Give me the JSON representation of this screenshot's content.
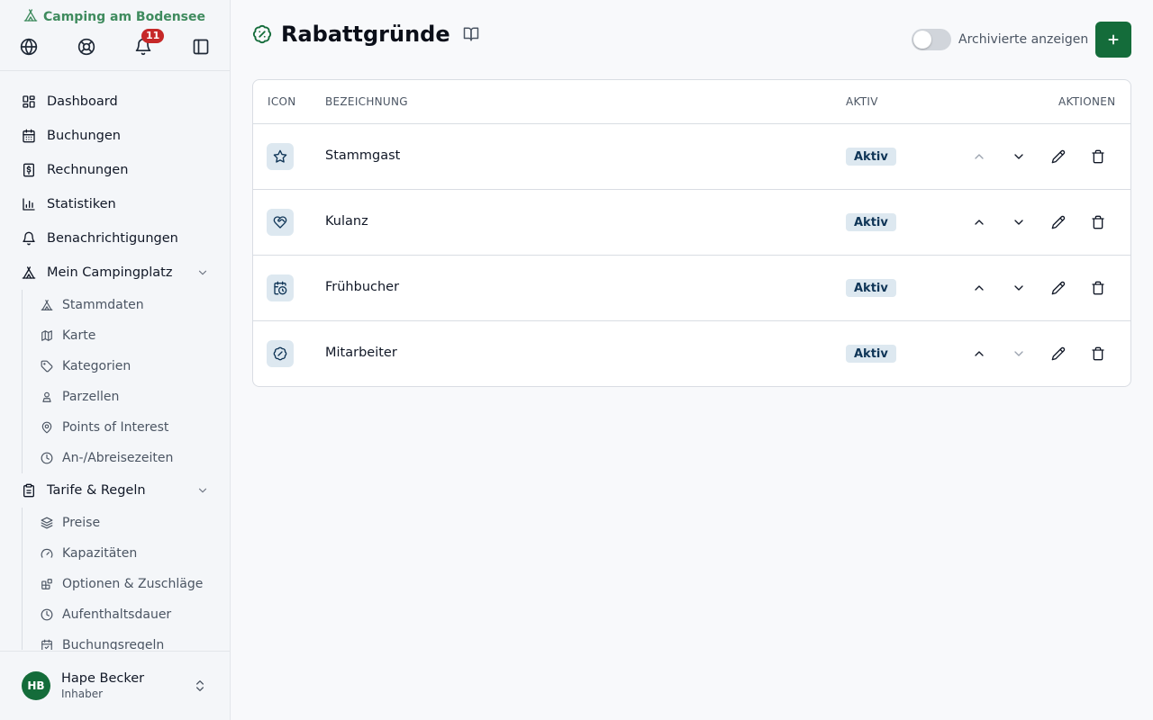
{
  "brand": {
    "name": "Camping am Bodensee",
    "icon": "tent-icon"
  },
  "topbar": {
    "notifications_count": "11",
    "icons": [
      "globe-icon",
      "lifebuoy-icon",
      "bell-icon",
      "sidebar-toggle-icon"
    ]
  },
  "nav": {
    "dashboard": "Dashboard",
    "buchungen": "Buchungen",
    "rechnungen": "Rechnungen",
    "statistiken": "Statistiken",
    "benachrichtigungen": "Benachrichtigungen",
    "mein_campingplatz": "Mein Campingplatz",
    "campingplatz_items": [
      "Stammdaten",
      "Karte",
      "Kategorien",
      "Parzellen",
      "Points of Interest",
      "An-/Abreisezeiten"
    ],
    "tarife": "Tarife & Regeln",
    "tarife_items": [
      "Preise",
      "Kapazitäten",
      "Optionen & Zuschläge",
      "Aufenthaltsdauer",
      "Buchungsregeln"
    ]
  },
  "user": {
    "initials": "HB",
    "name": "Hape Becker",
    "role": "Inhaber"
  },
  "page": {
    "title": "Rabattgründe",
    "toggle_label": "Archivierte anzeigen",
    "toggle_on": false
  },
  "table": {
    "headers": {
      "icon": "ICON",
      "name": "BEZEICHNUNG",
      "active": "AKTIV",
      "actions": "AKTIONEN"
    },
    "rows": [
      {
        "icon": "star-icon",
        "name": "Stammgast",
        "status": "Aktiv",
        "up_enabled": false,
        "down_enabled": true
      },
      {
        "icon": "heart-handshake-icon",
        "name": "Kulanz",
        "status": "Aktiv",
        "up_enabled": true,
        "down_enabled": true
      },
      {
        "icon": "calendar-clock-icon",
        "name": "Frühbucher",
        "status": "Aktiv",
        "up_enabled": true,
        "down_enabled": true
      },
      {
        "icon": "badge-percent-icon",
        "name": "Mitarbeiter",
        "status": "Aktiv",
        "up_enabled": true,
        "down_enabled": false
      }
    ]
  },
  "colors": {
    "accent": "#146c3a",
    "badge_bg": "#dde8f0",
    "badge_text": "#0f3557",
    "notification": "#c62828"
  }
}
